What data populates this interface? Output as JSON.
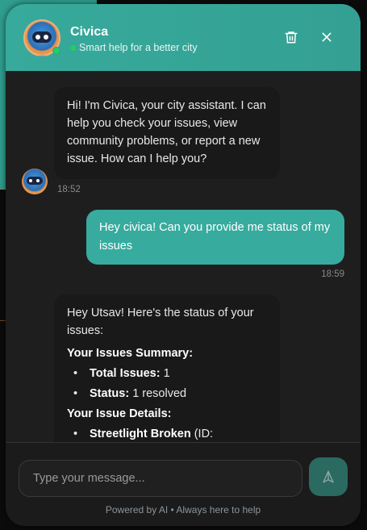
{
  "header": {
    "title": "Civica",
    "subtitle": "Smart help for a better city"
  },
  "messages": [
    {
      "from": "bot",
      "text": "Hi! I'm Civica, your city assistant. I can help you check your issues, view community problems, or report a new issue. How can I help you?",
      "time": "18:52"
    },
    {
      "from": "user",
      "text": "Hey civica! Can you provide me status of my issues",
      "time": "18:59"
    },
    {
      "from": "bot",
      "intro": "Hey Utsav! Here's the status of your issues:",
      "summary_heading": "Your Issues Summary:",
      "summary": [
        {
          "label": "Total Issues:",
          "value": "1"
        },
        {
          "label": "Status:",
          "value": "1 resolved"
        }
      ],
      "details_heading": "Your Issue Details:",
      "details": [
        {
          "label": "Streetlight Broken",
          "value": "(ID:"
        }
      ]
    }
  ],
  "composer": {
    "placeholder": "Type your message...",
    "footer": "Powered by AI • Always here to help"
  },
  "colors": {
    "accent": "#37ab9e",
    "online": "#22cc66"
  }
}
